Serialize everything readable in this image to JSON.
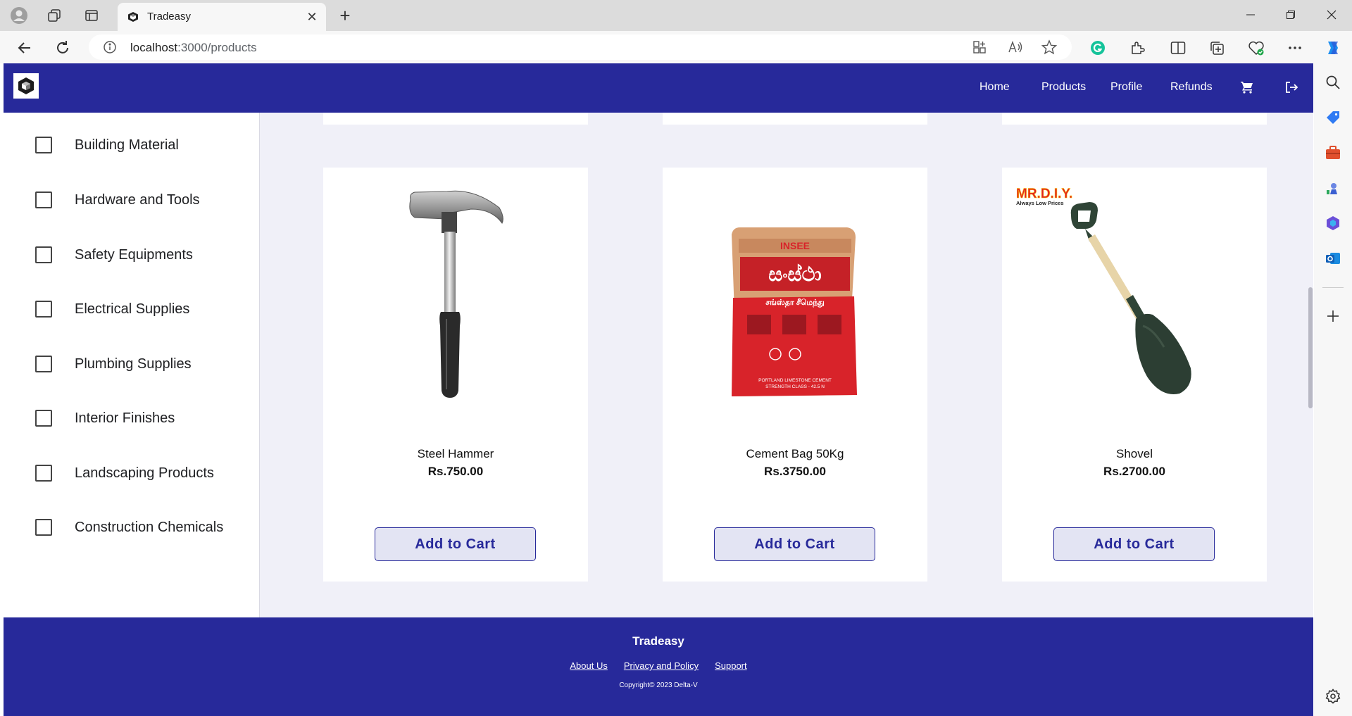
{
  "browser": {
    "tab_title": "Tradeasy",
    "url_host": "localhost",
    "url_path": ":3000/products"
  },
  "app": {
    "nav": {
      "home": "Home",
      "products": "Products",
      "profile": "Profile",
      "refunds": "Refunds"
    },
    "categories": [
      {
        "label": "Building Material",
        "checked": false
      },
      {
        "label": "Hardware and Tools",
        "checked": false
      },
      {
        "label": "Safety Equipments",
        "checked": false
      },
      {
        "label": "Electrical Supplies",
        "checked": false
      },
      {
        "label": "Plumbing Supplies",
        "checked": false
      },
      {
        "label": "Interior Finishes",
        "checked": false
      },
      {
        "label": "Landscaping Products",
        "checked": false
      },
      {
        "label": "Construction Chemicals",
        "checked": false
      }
    ],
    "products": [
      {
        "name": "Steel Hammer",
        "price": "Rs.750.00",
        "button": "Add to Cart"
      },
      {
        "name": "Cement Bag 50Kg",
        "price": "Rs.3750.00",
        "button": "Add to Cart",
        "image_text": {
          "brand": "INSEE",
          "sinhala": "සංස්ථා",
          "tamil": "சங்ஸ்தா சீமெந்து",
          "line1": "PORTLAND LIMESTONE CEMENT",
          "line2": "STRENGTH CLASS - 42.5 N"
        }
      },
      {
        "name": "Shovel",
        "price": "Rs.2700.00",
        "button": "Add to Cart",
        "image_text": {
          "brand": "MR.D.I.Y.",
          "tagline": "Always Low Prices"
        }
      }
    ],
    "footer": {
      "title": "Tradeasy",
      "links": [
        "About Us",
        "Privacy and Policy",
        "Support"
      ],
      "copyright": "Copyright© 2023 Delta-V"
    }
  },
  "colors": {
    "brand": "#27299a",
    "page_bg": "#f0f0f8",
    "button_bg": "#e3e4f3"
  }
}
